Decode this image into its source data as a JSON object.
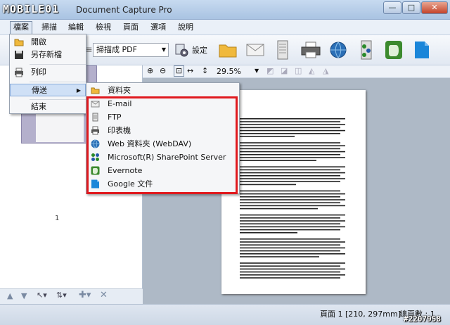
{
  "window": {
    "logo": "MOBILE01",
    "title": "Document Capture Pro",
    "controls": [
      "—",
      "□",
      "✕"
    ]
  },
  "menubar": [
    {
      "label": "檔案",
      "active": true
    },
    {
      "label": "掃描"
    },
    {
      "label": "編輯"
    },
    {
      "label": "檢視"
    },
    {
      "label": "頁面"
    },
    {
      "label": "選項"
    },
    {
      "label": "說明"
    }
  ],
  "toolbar": {
    "save_format": "掃描成 PDF",
    "settings_label": "設定"
  },
  "file_menu": [
    {
      "label": "開啟",
      "icon": "folder-open-icon"
    },
    {
      "label": "另存新檔",
      "icon": "floppy-disk-icon"
    },
    {
      "label": "列印",
      "icon": "printer-icon"
    },
    {
      "label": "傳送",
      "icon": "",
      "highlighted": true,
      "submenu": true
    },
    {
      "label": "結束",
      "icon": ""
    }
  ],
  "send_submenu": [
    {
      "label": "資料夾",
      "icon": "folder-icon"
    },
    {
      "label": "E-mail",
      "icon": "envelope-icon"
    },
    {
      "label": "FTP",
      "icon": "server-icon"
    },
    {
      "label": "印表機",
      "icon": "printer-icon"
    },
    {
      "label": "Web 資料夾 (WebDAV)",
      "icon": "globe-icon"
    },
    {
      "label": "Microsoft(R) SharePoint Server",
      "icon": "sharepoint-icon"
    },
    {
      "label": "Evernote",
      "icon": "evernote-icon"
    },
    {
      "label": "Google 文件",
      "icon": "google-docs-icon"
    }
  ],
  "thumbnail": {
    "page_number": "1"
  },
  "view": {
    "zoom": "29.5%"
  },
  "status": {
    "page_info": "頁面 1 [210, 297mm]",
    "total_pages": "總頁數 : 1"
  },
  "watermark": "#2207958",
  "colors": {
    "highlight_box": "#e0191e",
    "menu_highlight": "#cfe0f6"
  }
}
